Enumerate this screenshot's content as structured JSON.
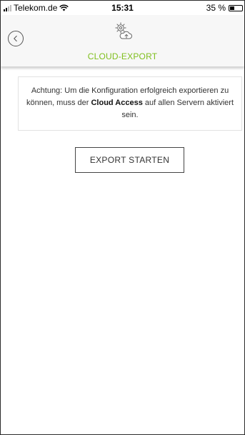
{
  "status_bar": {
    "carrier": "Telekom.de",
    "time": "15:31",
    "battery": "35 %",
    "battery_level": 0.35,
    "signal_icon": "signal-icon",
    "wifi_icon": "wifi-icon",
    "battery_icon": "battery-icon"
  },
  "header": {
    "back_icon": "chevron-left-icon",
    "title_icon": "cloud-gear-icon",
    "title": "CLOUD-EXPORT"
  },
  "notice": {
    "text_before": "Achtung: Um die Konfiguration erfolgreich exportieren zu können, muss der ",
    "bold": "Cloud Access",
    "text_after": " auf allen Servern aktiviert sein."
  },
  "actions": {
    "export_button_label": "EXPORT STARTEN"
  },
  "colors": {
    "accent": "#7fbf1d",
    "header_bg": "#f7f7f7"
  }
}
